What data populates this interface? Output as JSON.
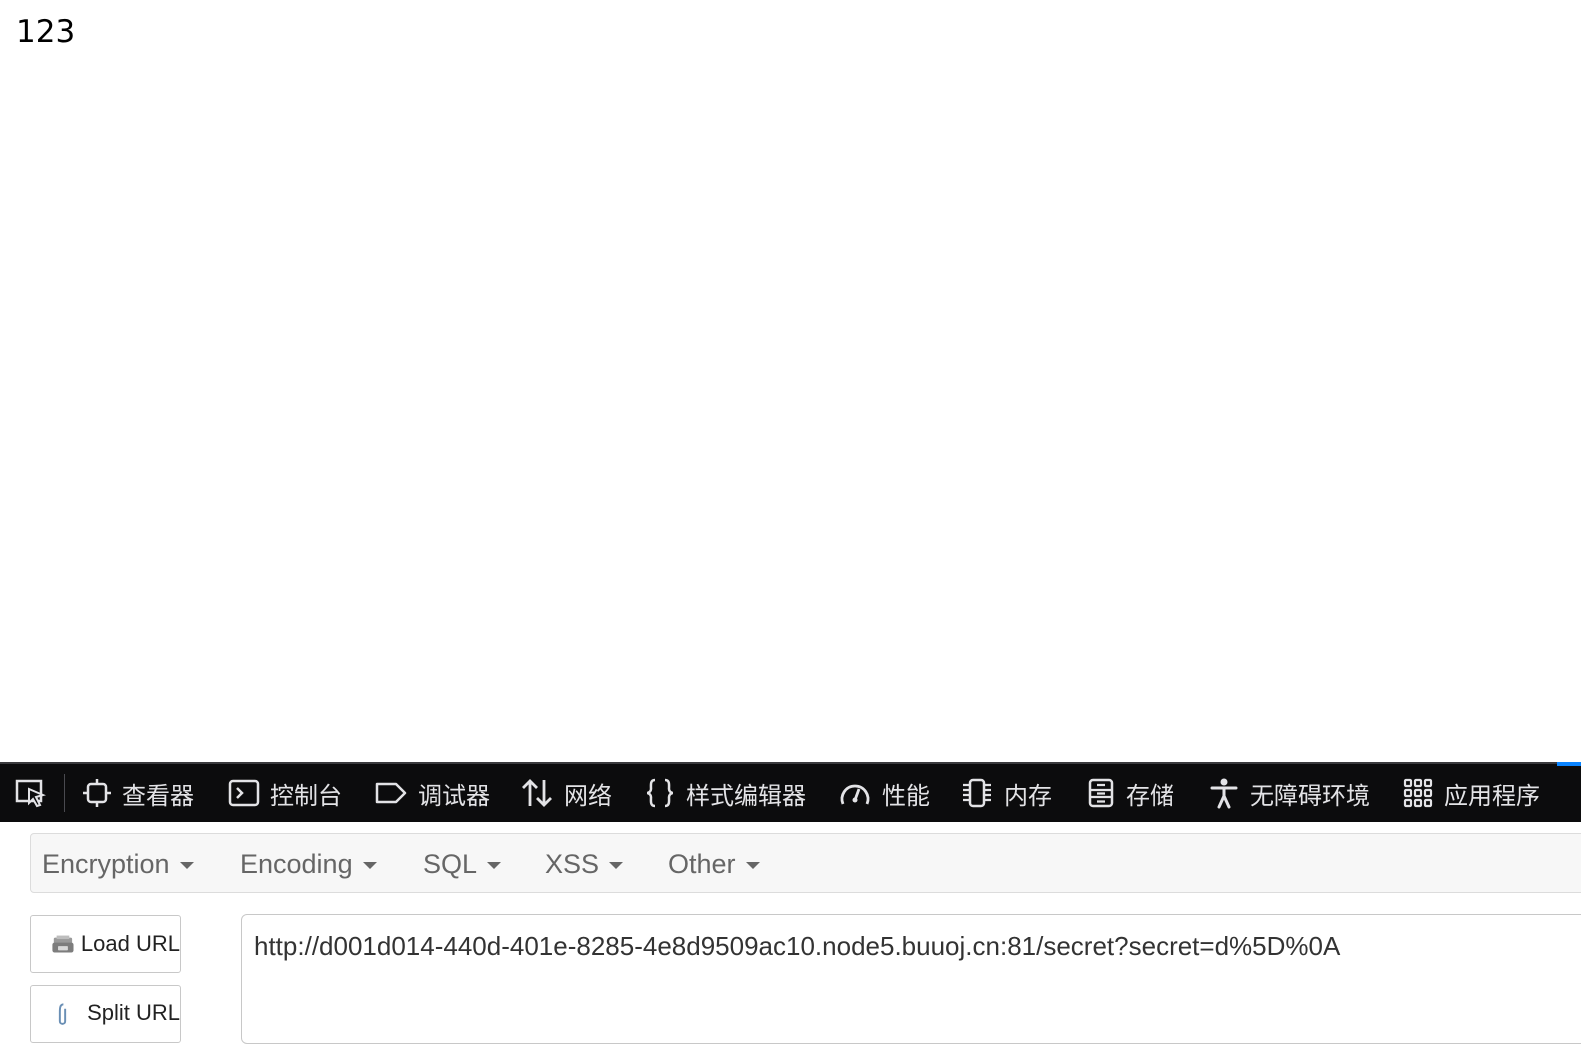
{
  "page": {
    "body_text": "123"
  },
  "devtools": {
    "tabs": [
      {
        "label": "查看器",
        "icon": "inspector-icon"
      },
      {
        "label": "控制台",
        "icon": "console-icon"
      },
      {
        "label": "调试器",
        "icon": "debugger-icon"
      },
      {
        "label": "网络",
        "icon": "network-icon"
      },
      {
        "label": "样式编辑器",
        "icon": "style-editor-icon"
      },
      {
        "label": "性能",
        "icon": "performance-icon"
      },
      {
        "label": "内存",
        "icon": "memory-icon"
      },
      {
        "label": "存储",
        "icon": "storage-icon"
      },
      {
        "label": "无障碍环境",
        "icon": "accessibility-icon"
      },
      {
        "label": "应用程序",
        "icon": "application-icon"
      }
    ],
    "accent_color": "#0a84ff"
  },
  "hackbar": {
    "menu": [
      "Encryption",
      "Encoding",
      "SQL",
      "XSS",
      "Other"
    ],
    "load_url_label": "Load URL",
    "split_url_label": "Split URL",
    "url_value": "http://d001d014-440d-401e-8285-4e8d9509ac10.node5.buuoj.cn:81/secret?secret=d%5D%0A"
  }
}
